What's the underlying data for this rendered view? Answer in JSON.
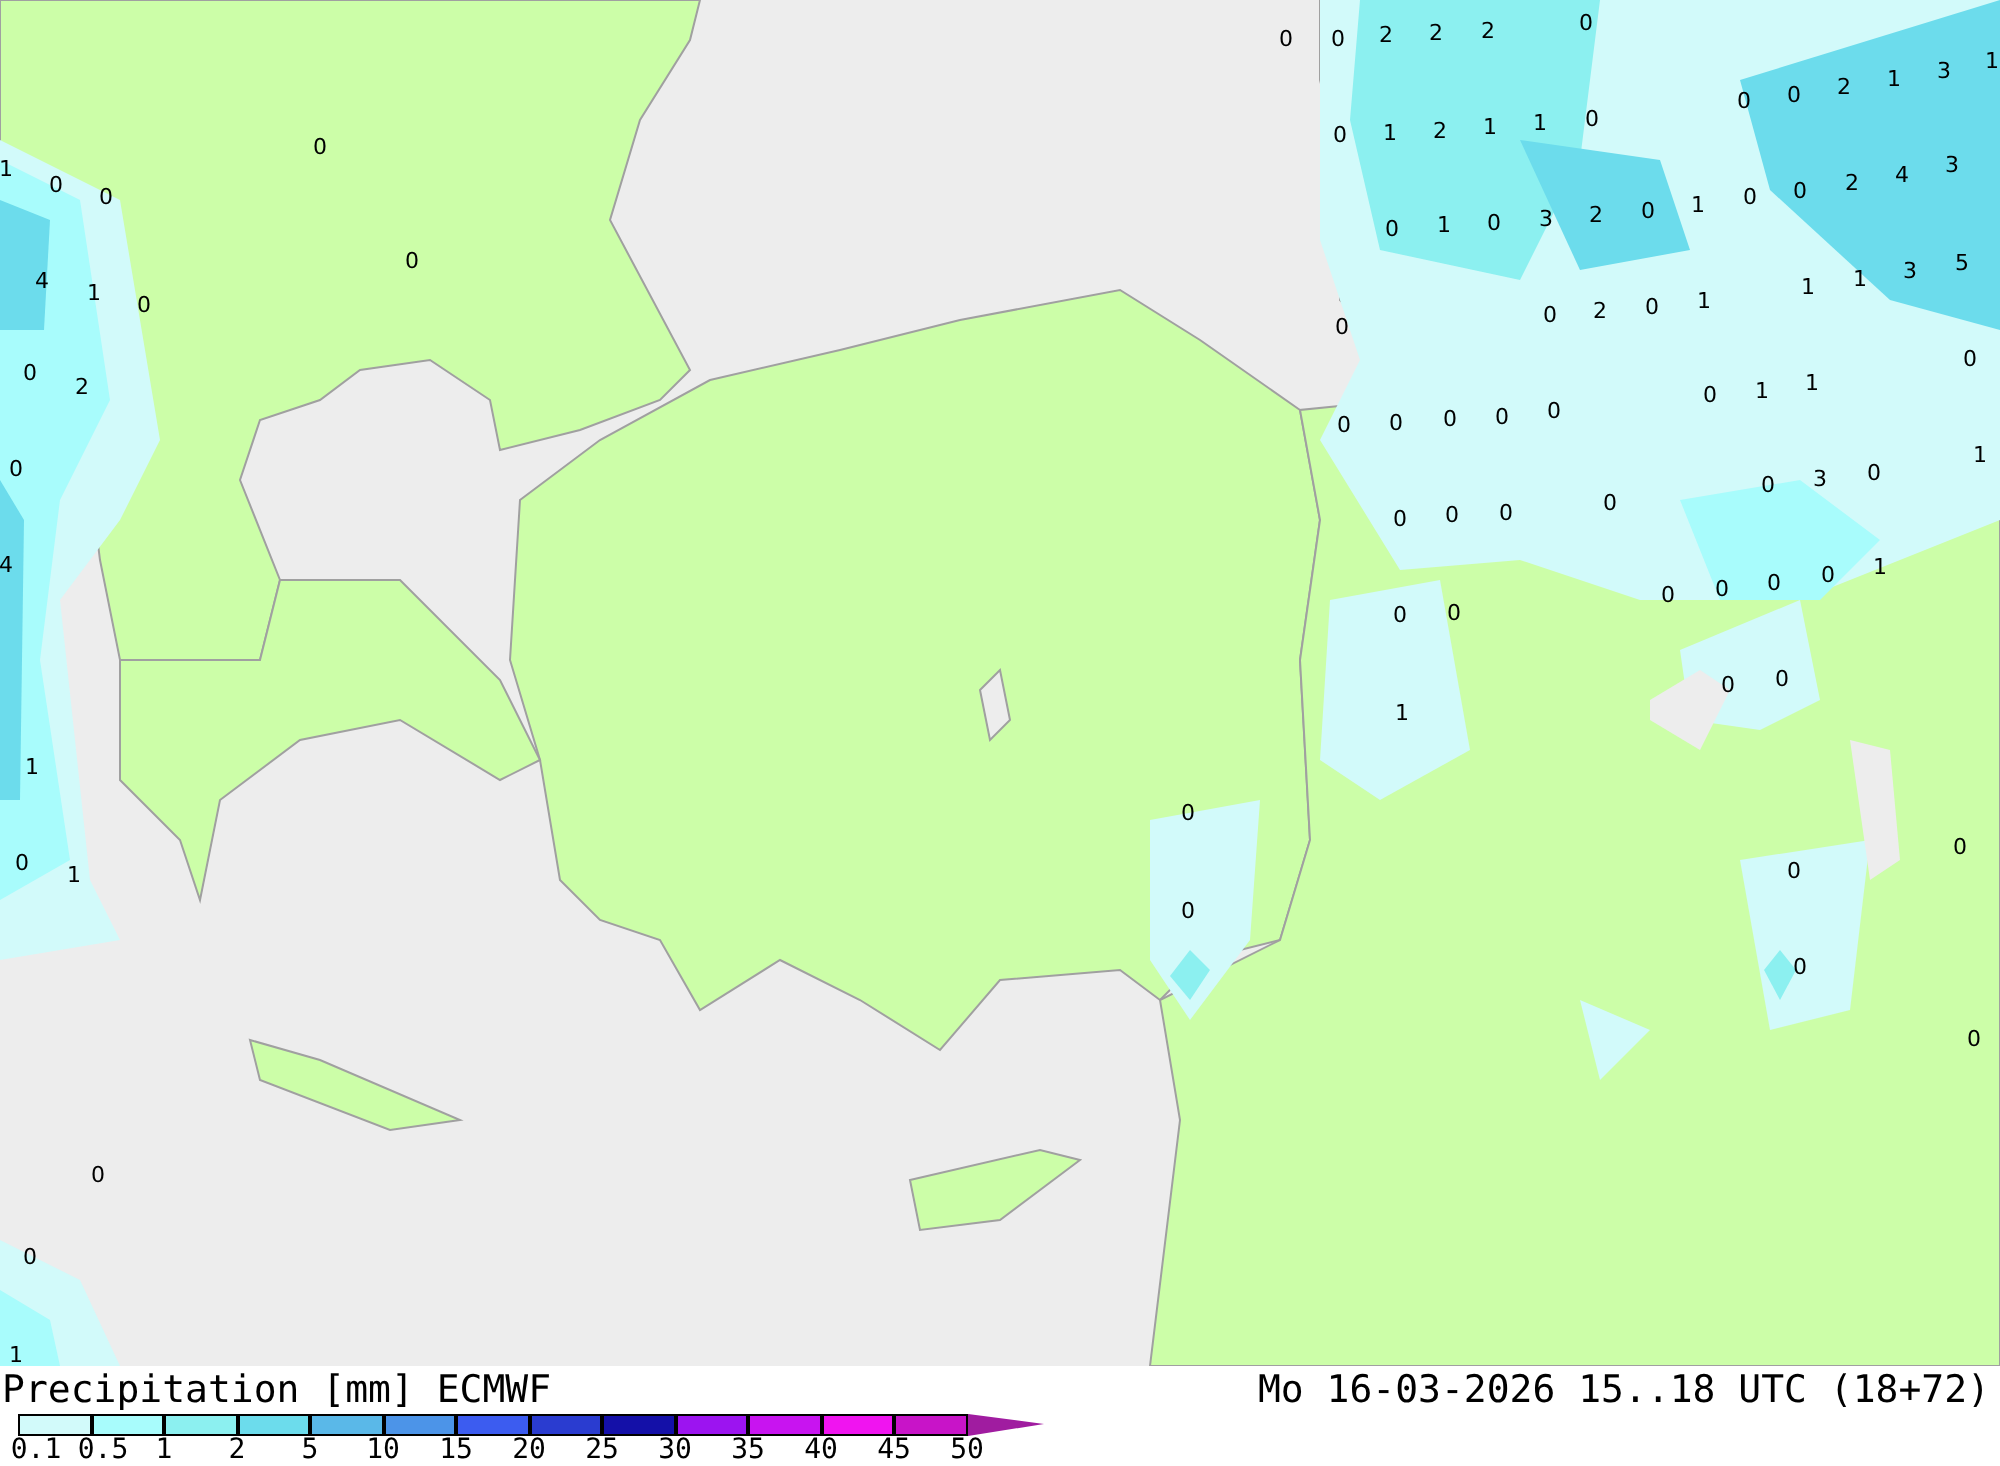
{
  "map": {
    "labels": [
      {
        "text": "0"
      },
      {
        "text": "0"
      },
      {
        "text": "2"
      },
      {
        "text": "2"
      },
      {
        "text": "2"
      },
      {
        "text": "0"
      },
      {
        "text": "0"
      },
      {
        "text": "1"
      },
      {
        "text": "2"
      },
      {
        "text": "1"
      },
      {
        "text": "1"
      },
      {
        "text": "0"
      },
      {
        "text": "0"
      },
      {
        "text": "0"
      },
      {
        "text": "2"
      },
      {
        "text": "1"
      },
      {
        "text": "3"
      },
      {
        "text": "1"
      },
      {
        "text": "0"
      },
      {
        "text": "1"
      },
      {
        "text": "0"
      },
      {
        "text": "3"
      },
      {
        "text": "2"
      },
      {
        "text": "0"
      },
      {
        "text": "1"
      },
      {
        "text": "0"
      },
      {
        "text": "0"
      },
      {
        "text": "2"
      },
      {
        "text": "4"
      },
      {
        "text": "3"
      },
      {
        "text": "0"
      },
      {
        "text": "0"
      },
      {
        "text": "2"
      },
      {
        "text": "0"
      },
      {
        "text": "1"
      },
      {
        "text": "1"
      },
      {
        "text": "1"
      },
      {
        "text": "3"
      },
      {
        "text": "5"
      },
      {
        "text": "0"
      },
      {
        "text": "0"
      },
      {
        "text": "1"
      },
      {
        "text": "1"
      },
      {
        "text": "0"
      },
      {
        "text": "0"
      },
      {
        "text": "0"
      },
      {
        "text": "0"
      },
      {
        "text": "0"
      },
      {
        "text": "0"
      },
      {
        "text": "3"
      },
      {
        "text": "0"
      },
      {
        "text": "1"
      },
      {
        "text": "0"
      },
      {
        "text": "0"
      },
      {
        "text": "0"
      },
      {
        "text": "0"
      },
      {
        "text": "0"
      },
      {
        "text": "0"
      },
      {
        "text": "0"
      },
      {
        "text": "0"
      },
      {
        "text": "1"
      },
      {
        "text": "0"
      },
      {
        "text": "0"
      },
      {
        "text": "0"
      },
      {
        "text": "0"
      },
      {
        "text": "1"
      },
      {
        "text": "0"
      },
      {
        "text": "0"
      },
      {
        "text": "0"
      },
      {
        "text": "0"
      },
      {
        "text": "0"
      },
      {
        "text": "0"
      },
      {
        "text": "1"
      },
      {
        "text": "0"
      },
      {
        "text": "0"
      },
      {
        "text": "0"
      },
      {
        "text": "0"
      },
      {
        "text": "4"
      },
      {
        "text": "1"
      },
      {
        "text": "0"
      },
      {
        "text": "0"
      },
      {
        "text": "2"
      },
      {
        "text": "0"
      },
      {
        "text": "4"
      },
      {
        "text": "1"
      },
      {
        "text": "0"
      },
      {
        "text": "1"
      },
      {
        "text": "0"
      },
      {
        "text": "0"
      },
      {
        "text": "1"
      }
    ]
  },
  "legend": {
    "title": "Precipitation [mm] ECMWF",
    "valid_time": "Mo 16-03-2026 15..18 UTC (18+72)",
    "scale": [
      {
        "kind": "box",
        "color": "#d2fafa"
      },
      {
        "kind": "box",
        "color": "#a8fcfc"
      },
      {
        "kind": "box",
        "color": "#8cf0f0"
      },
      {
        "kind": "box",
        "color": "#6cdcec"
      },
      {
        "kind": "box",
        "color": "#5ab8e8"
      },
      {
        "kind": "box",
        "color": "#4c94e8"
      },
      {
        "kind": "box",
        "color": "#3c5cf0"
      },
      {
        "kind": "box",
        "color": "#2a3cd0"
      },
      {
        "kind": "box",
        "color": "#1410a8"
      },
      {
        "kind": "box",
        "color": "#9c14f0"
      },
      {
        "kind": "box",
        "color": "#c814f0"
      },
      {
        "kind": "box",
        "color": "#f014f0"
      },
      {
        "kind": "box",
        "color": "#c814c8"
      },
      {
        "kind": "arrow",
        "color": "#a01ca0"
      }
    ],
    "ticks": [
      "0.1",
      "0.5",
      "1",
      "2",
      "5",
      "10",
      "15",
      "20",
      "25",
      "30",
      "35",
      "40",
      "45",
      "50"
    ]
  }
}
